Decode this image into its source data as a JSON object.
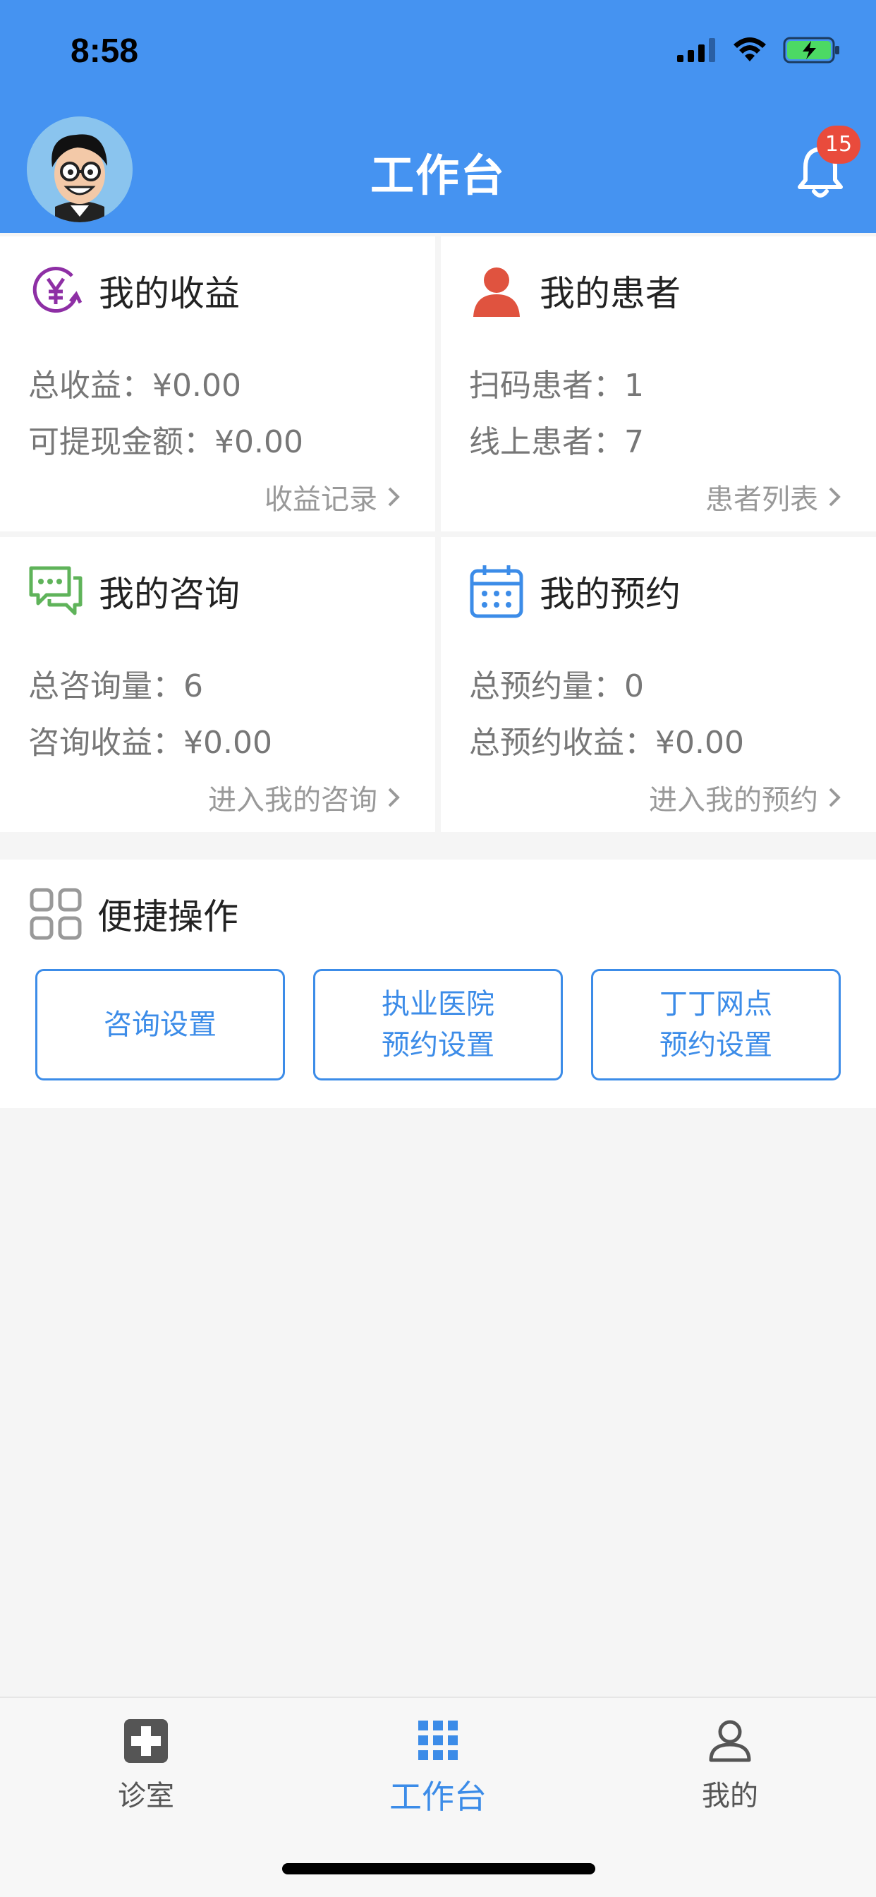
{
  "status": {
    "time": "8:58"
  },
  "header": {
    "title": "工作台",
    "notification_count": "15"
  },
  "cards": [
    {
      "title": "我的收益",
      "line1": "总收益：¥0.00",
      "line2": "可提现金额：¥0.00",
      "link": "收益记录",
      "icon": "yuan-refresh-icon",
      "color": "#8e2fa5"
    },
    {
      "title": "我的患者",
      "line1": "扫码患者：1",
      "line2": "线上患者：7",
      "link": "患者列表",
      "icon": "person-icon",
      "color": "#e0533f"
    },
    {
      "title": "我的咨询",
      "line1": "总咨询量：6",
      "line2": "咨询收益：¥0.00",
      "link": "进入我的咨询",
      "icon": "chat-bubbles-icon",
      "color": "#5fb35a"
    },
    {
      "title": "我的预约",
      "line1": "总预约量：0",
      "line2": "总预约收益：¥0.00",
      "link": "进入我的预约",
      "icon": "calendar-icon",
      "color": "#3c8ce8"
    }
  ],
  "quick": {
    "title": "便捷操作",
    "buttons": [
      {
        "line1": "咨询设置",
        "line2": ""
      },
      {
        "line1": "执业医院",
        "line2": "预约设置"
      },
      {
        "line1": "丁丁网点",
        "line2": "预约设置"
      }
    ]
  },
  "tabs": [
    {
      "label": "诊室",
      "icon": "medical-cross-icon",
      "active": false
    },
    {
      "label": "工作台",
      "icon": "grid-icon",
      "active": true
    },
    {
      "label": "我的",
      "icon": "user-icon",
      "active": false
    }
  ],
  "colors": {
    "primary": "#4593f1",
    "accent": "#3c8ce8",
    "badge": "#e94b3c"
  }
}
